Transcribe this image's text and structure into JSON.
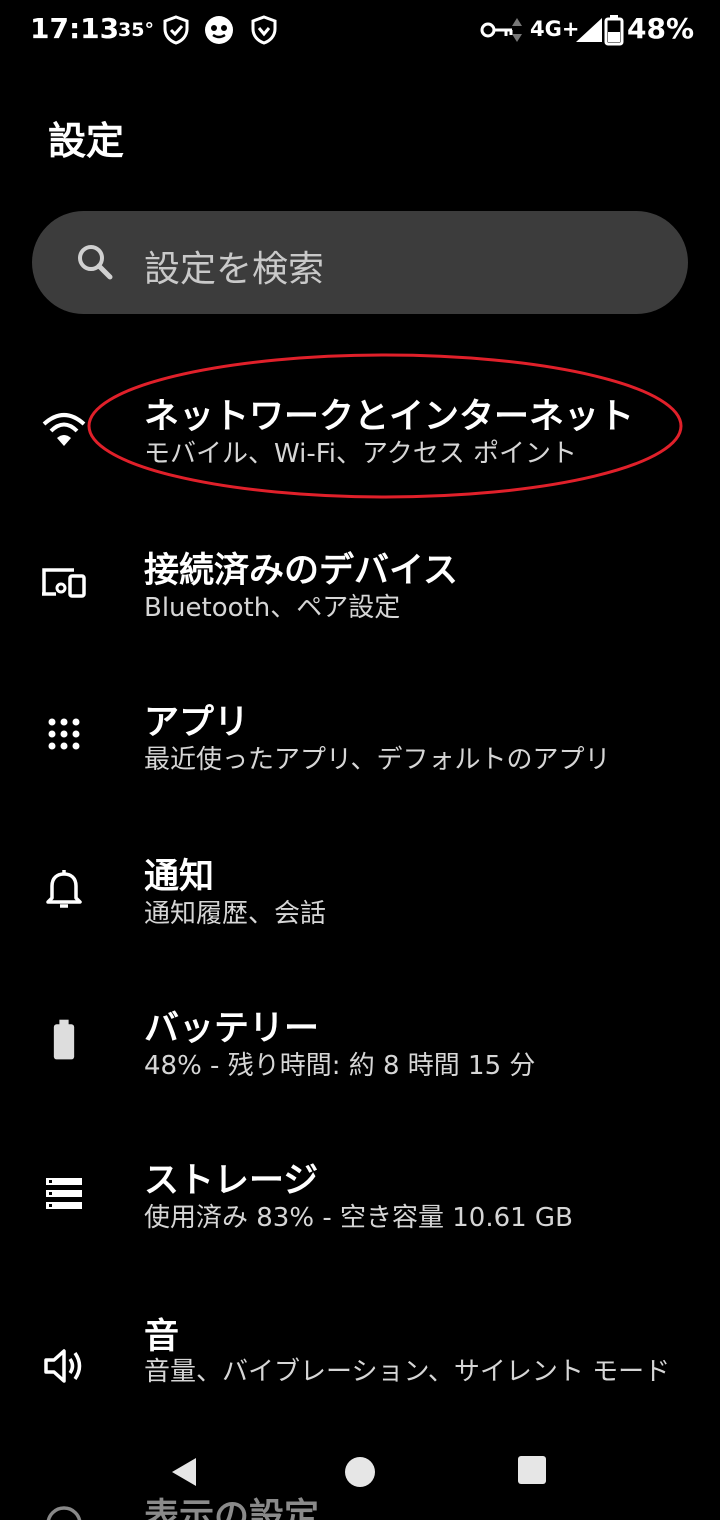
{
  "status_bar": {
    "time": "17:13",
    "temperature": "35°",
    "network": "4G+",
    "battery": "48%"
  },
  "page_title": "設定",
  "search": {
    "placeholder": "設定を検索"
  },
  "items": [
    {
      "title": "ネットワークとインターネット",
      "subtitle": "モバイル、Wi-Fi、アクセス ポイント",
      "icon": "wifi-icon"
    },
    {
      "title": "接続済みのデバイス",
      "subtitle": "Bluetooth、ペア設定",
      "icon": "devices-icon"
    },
    {
      "title": "アプリ",
      "subtitle": "最近使ったアプリ、デフォルトのアプリ",
      "icon": "apps-grid-icon"
    },
    {
      "title": "通知",
      "subtitle": "通知履歴、会話",
      "icon": "bell-icon"
    },
    {
      "title": "バッテリー",
      "subtitle": "48% - 残り時間: 約 8 時間 15 分",
      "icon": "battery-icon"
    },
    {
      "title": "ストレージ",
      "subtitle": "使用済み 83% - 空き容量 10.61 GB",
      "icon": "storage-icon"
    },
    {
      "title": "音",
      "subtitle": "音量、バイブレーション、サイレント モード",
      "icon": "volume-icon"
    },
    {
      "title": "表示の設定",
      "subtitle": "",
      "icon": "display-icon"
    }
  ],
  "colors": {
    "background": "#000000",
    "search_bg": "#3c3c3c",
    "highlight": "#e0202a"
  }
}
